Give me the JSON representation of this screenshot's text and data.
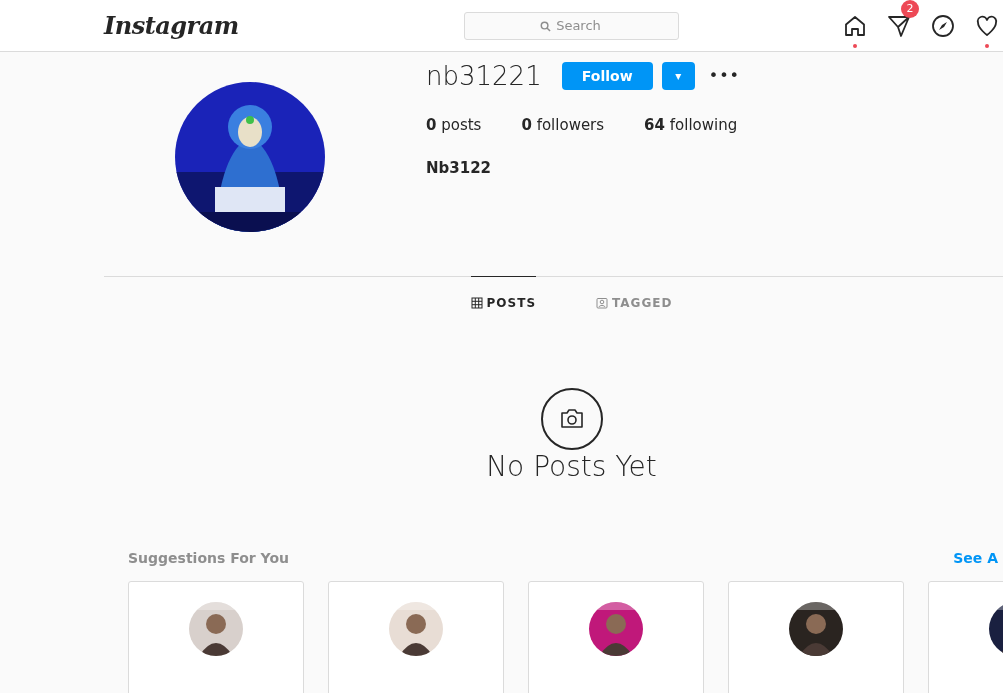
{
  "header": {
    "logo": "Instagram",
    "search": {
      "placeholder": "Search"
    },
    "nav_icons": [
      {
        "kind": "home",
        "dot": true
      },
      {
        "kind": "direct",
        "dot": false,
        "badge": "2"
      },
      {
        "kind": "explore",
        "dot": false
      },
      {
        "kind": "activity",
        "dot": true
      }
    ]
  },
  "profile": {
    "username": "nb31221",
    "follow_button": "Follow",
    "dropdown_button": "▾",
    "more_button": "•••",
    "stats": [
      {
        "count": "0",
        "label": "posts"
      },
      {
        "count": "0",
        "label": "followers"
      },
      {
        "count": "64",
        "label": "following"
      }
    ],
    "full_name": "Nb3122"
  },
  "tabs": [
    {
      "kind": "grid",
      "label": "POSTS",
      "selected": true
    },
    {
      "kind": "tagged",
      "label": "TAGGED",
      "selected": false
    }
  ],
  "empty_state": {
    "title": "No Posts Yet"
  },
  "suggestions": {
    "title": "Suggestions For You",
    "see_all": "See A"
  }
}
